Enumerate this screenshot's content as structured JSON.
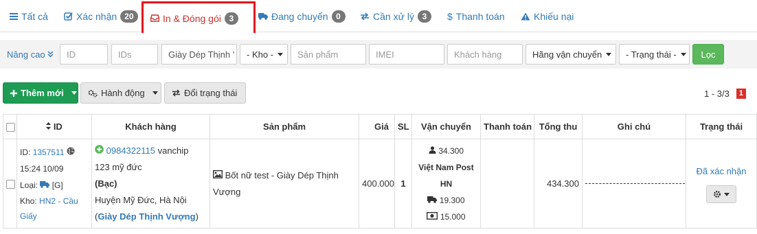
{
  "tabs": [
    {
      "label": "Tất cả",
      "badge": null
    },
    {
      "label": "Xác nhận",
      "badge": "20"
    },
    {
      "label": "In & Đóng gói",
      "badge": "3",
      "active": true
    },
    {
      "label": "Đang chuyển",
      "badge": "0"
    },
    {
      "label": "Cần xử lý",
      "badge": "3"
    },
    {
      "label": "Thanh toán",
      "badge": null
    },
    {
      "label": "Khiếu nại",
      "badge": null
    }
  ],
  "filters": {
    "advanced_label": "Nâng cao",
    "id_placeholder": "ID",
    "ids_placeholder": "IDs",
    "shop_value": "Giày Dép Thịnh '",
    "warehouse_select": "- Kho -",
    "product_placeholder": "Sản phẩm",
    "imei_placeholder": "IMEI",
    "customer_placeholder": "Khách hàng",
    "carrier_select": "Hãng vận chuyển",
    "status_select": "- Trạng thái -",
    "filter_button": "Lọc"
  },
  "actions": {
    "add_new": "Thêm mới",
    "actions": "Hành động",
    "change_status": "Đổi trạng thái"
  },
  "pagination": {
    "range": "1 - 3/3",
    "page": "1"
  },
  "table": {
    "headers": {
      "id": "ID",
      "customer": "Khách hàng",
      "product": "Sản phẩm",
      "price": "Giá",
      "qty": "SL",
      "shipping": "Vận chuyển",
      "payment": "Thanh toán",
      "total": "Tổng thu",
      "note": "Ghi chú",
      "status": "Trạng thái"
    },
    "rows": [
      {
        "id_label": "ID:",
        "id": "1357511",
        "datetime": "15:24 10/09",
        "type_label": "Loại:",
        "type_value": "[G]",
        "warehouse_label": "Kho:",
        "warehouse": "HN2 - Cầu Giấy",
        "customer_phone": "0984322115",
        "customer_name": "vanchip",
        "address_line": "123 mỹ đức",
        "level": "(Bạc)",
        "district": "Huyện Mỹ Đức, Hà Nội",
        "shop_open": "(",
        "shop": "Giày Dép Thịnh Vượng",
        "shop_close": ")",
        "product": "Bốt nữ test - Giày Dép Thịnh Vượng",
        "price": "400.000",
        "qty": "1",
        "ship_customer_fee": "34.300",
        "carrier": "Việt Nam Post HN",
        "ship_fee": "19.300",
        "cod_fee": "15.000",
        "payment": "",
        "total": "434.300",
        "status": "Đã xác nhận"
      }
    ]
  }
}
